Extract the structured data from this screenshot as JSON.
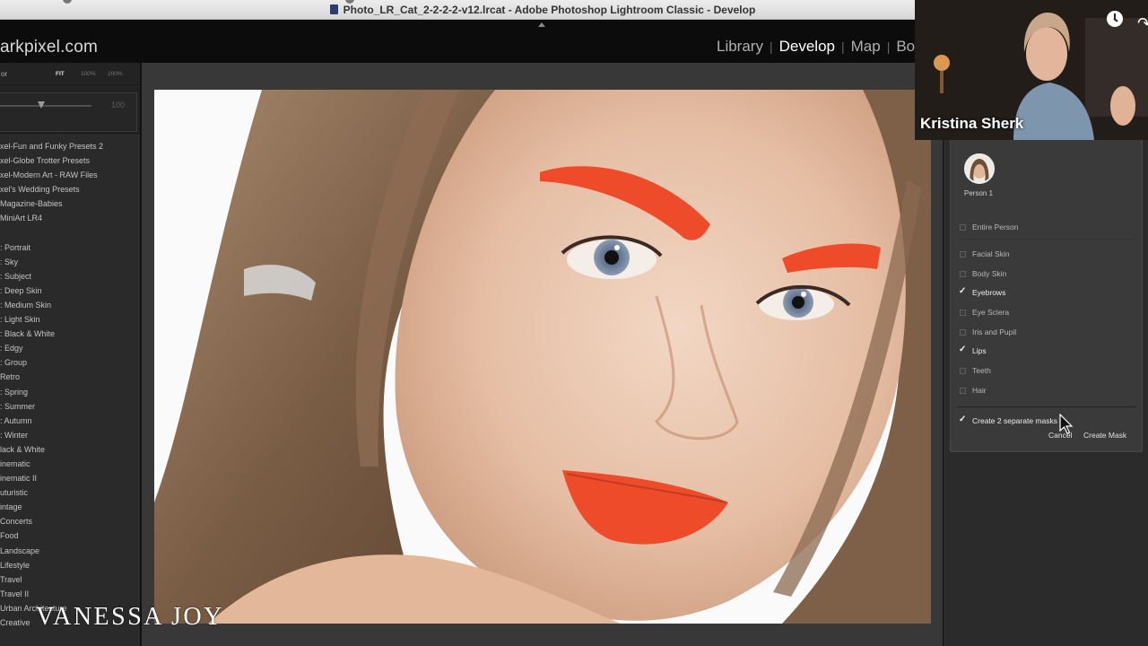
{
  "window": {
    "title": "Photo_LR_Cat_2-2-2-2-v12.lrcat - Adobe Photoshop Lightroom Classic - Develop"
  },
  "identity_plate": "arkpixel.com",
  "modules": [
    {
      "label": "Library",
      "active": false
    },
    {
      "label": "Develop",
      "active": true
    },
    {
      "label": "Map",
      "active": false
    },
    {
      "label": "Bo",
      "active": false
    }
  ],
  "navigator": {
    "title": "or",
    "zoom_fit": "FIT",
    "zoom_100": "100%",
    "zoom_200": "200%",
    "slider_value": "100"
  },
  "presets_group_a": [
    "xel-Fun and Funky Presets 2",
    "xel-Globe Trotter Presets",
    "xel-Modern Art - RAW Files",
    "xel's Wedding Presets",
    "Magazine-Babies",
    "MiniArt LR4"
  ],
  "presets_group_b": [
    ": Portrait",
    ": Sky",
    ": Subject",
    ": Deep Skin",
    ": Medium Skin",
    ": Light Skin",
    ": Black & White",
    ": Edgy",
    ": Group",
    "Retro",
    ": Spring",
    ": Summer",
    ": Autumn",
    ": Winter",
    "lack & White",
    "inematic",
    "inematic II",
    "uturistic",
    "intage",
    " Concerts",
    " Food",
    " Landscape",
    " Lifestyle",
    " Travel",
    " Travel II",
    " Urban Architecture",
    "Creative"
  ],
  "mask_panel": {
    "person_label": "Person 1",
    "options": [
      {
        "label": "Entire Person",
        "checked": false
      },
      {
        "label": "Facial Skin",
        "checked": false
      },
      {
        "label": "Body Skin",
        "checked": false
      },
      {
        "label": "Eyebrows",
        "checked": true
      },
      {
        "label": "Eye Sclera",
        "checked": false
      },
      {
        "label": "Iris and Pupil",
        "checked": false
      },
      {
        "label": "Lips",
        "checked": true
      },
      {
        "label": "Teeth",
        "checked": false
      },
      {
        "label": "Hair",
        "checked": false
      }
    ],
    "separate_masks_label": "Create 2 separate masks",
    "separate_masks_checked": true,
    "cancel_label": "Cancel",
    "create_label": "Create Mask"
  },
  "webcam": {
    "name": "Kristina Sherk"
  },
  "watermark": "VANESSA JOY",
  "colors": {
    "mask_overlay": "#ee4b2b",
    "panel_bg": "#2b2b2b",
    "module_bar_bg": "#0c0c0c"
  }
}
